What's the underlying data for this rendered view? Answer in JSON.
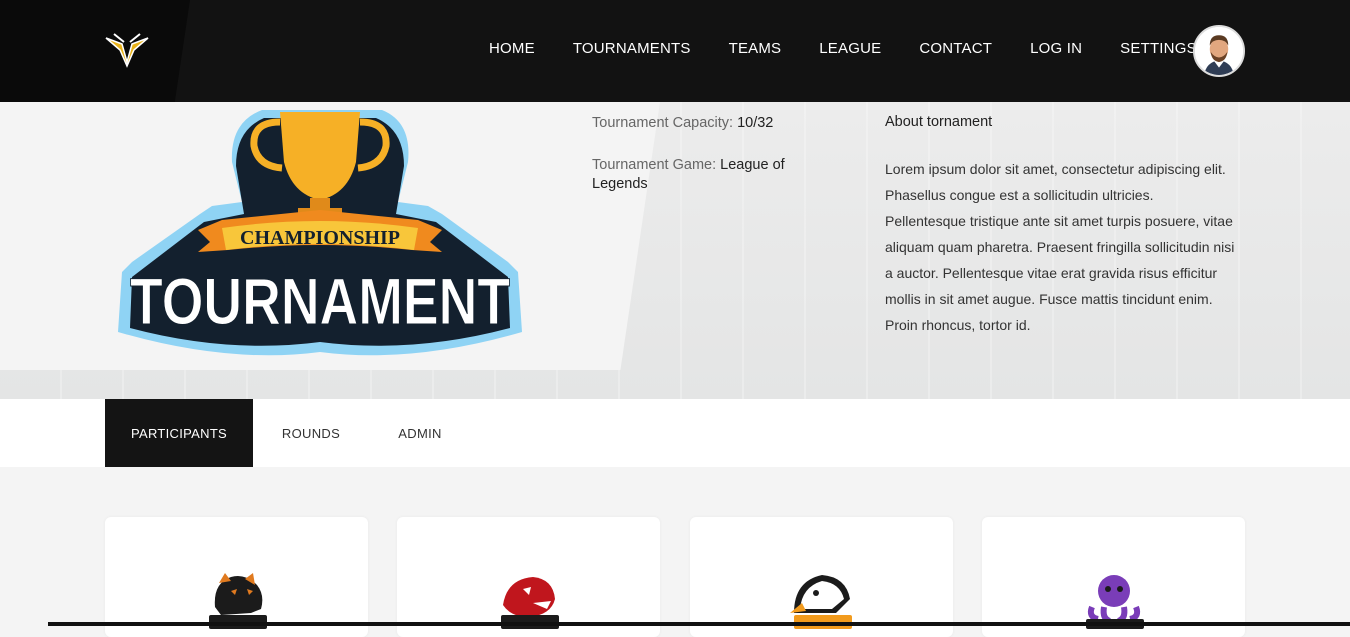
{
  "nav": {
    "items": [
      {
        "label": "HOME"
      },
      {
        "label": "TOURNAMENTS"
      },
      {
        "label": "TEAMS"
      },
      {
        "label": "LEAGUE"
      },
      {
        "label": "CONTACT"
      },
      {
        "label": "LOG IN"
      },
      {
        "label": "SETTINGS"
      }
    ]
  },
  "hero": {
    "badge_top": "CHAMPIONSHIP",
    "badge_main": "TOURNAMENT",
    "capacity_label": "Tournament Capacity:",
    "capacity_value": "10/32",
    "game_label": "Tournament Game:",
    "game_value": "League of Legends",
    "about_title": "About tornament",
    "about_text": "Lorem ipsum dolor sit amet, consectetur adipiscing elit. Phasellus congue est a sollicitudin ultricies. Pellentesque tristique ante sit amet turpis posuere, vitae aliquam quam pharetra. Praesent fringilla sollicitudin nisi a auctor. Pellentesque vitae erat gravida risus efficitur mollis in sit amet augue. Fusce mattis tincidunt enim. Proin rhoncus, tortor id."
  },
  "tabs": [
    {
      "label": "PARTICIPANTS",
      "active": true
    },
    {
      "label": "ROUNDS",
      "active": false
    },
    {
      "label": "ADMIN",
      "active": false
    }
  ],
  "participants": [
    {
      "icon": "panther-mascot-icon",
      "color": "#e07a1f"
    },
    {
      "icon": "piranha-mascot-icon",
      "color": "#c0161d"
    },
    {
      "icon": "eagle-mascot-icon",
      "color": "#f29b1d"
    },
    {
      "icon": "octopus-mascot-icon",
      "color": "#7a3db8"
    }
  ],
  "colors": {
    "header_bg": "#121212",
    "badge_outline": "#8fd3f4",
    "badge_dark": "#13202e",
    "trophy_gold": "#f6b026",
    "active_tab": "#141414"
  }
}
